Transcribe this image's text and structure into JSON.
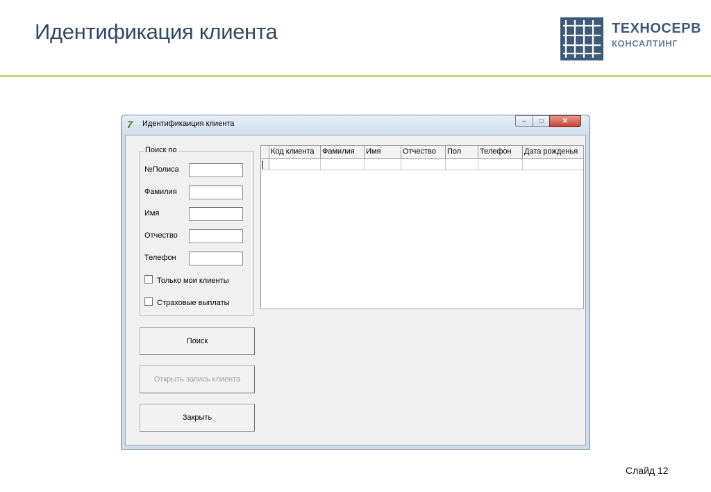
{
  "slide": {
    "title": "Идентификация клиента",
    "slide_number": "Слайд 12"
  },
  "logo": {
    "line1": "ТЕХНОСЕРВ",
    "line2": "КОНСАЛТИНГ"
  },
  "window": {
    "title": "Идентификаиция клиента",
    "app_icon": "application-icon",
    "controls": {
      "minimize": "–",
      "maximize": "□",
      "close": "✕"
    }
  },
  "search": {
    "group_label": "Поиск по",
    "fields": [
      {
        "label": "№Полиса",
        "value": ""
      },
      {
        "label": "Фамилия",
        "value": ""
      },
      {
        "label": "Имя",
        "value": ""
      },
      {
        "label": "Отчество",
        "value": ""
      },
      {
        "label": "Телефон",
        "value": ""
      }
    ],
    "checkboxes": [
      {
        "label": "Только мои клиенты",
        "checked": false
      },
      {
        "label": "Страховые выплаты",
        "checked": false
      }
    ]
  },
  "buttons": {
    "search": "Поиск",
    "open_record": "Открыть запись клиента",
    "close": "Закрыть"
  },
  "grid": {
    "columns": [
      "Код клиента",
      "Фамилия",
      "Имя",
      "Отчество",
      "Пол",
      "Телефон",
      "Дата рожденья"
    ],
    "rows": []
  },
  "colors": {
    "title": "#2f4a66",
    "accent_line": "#c9d27a",
    "logo": "#3d5a78"
  }
}
